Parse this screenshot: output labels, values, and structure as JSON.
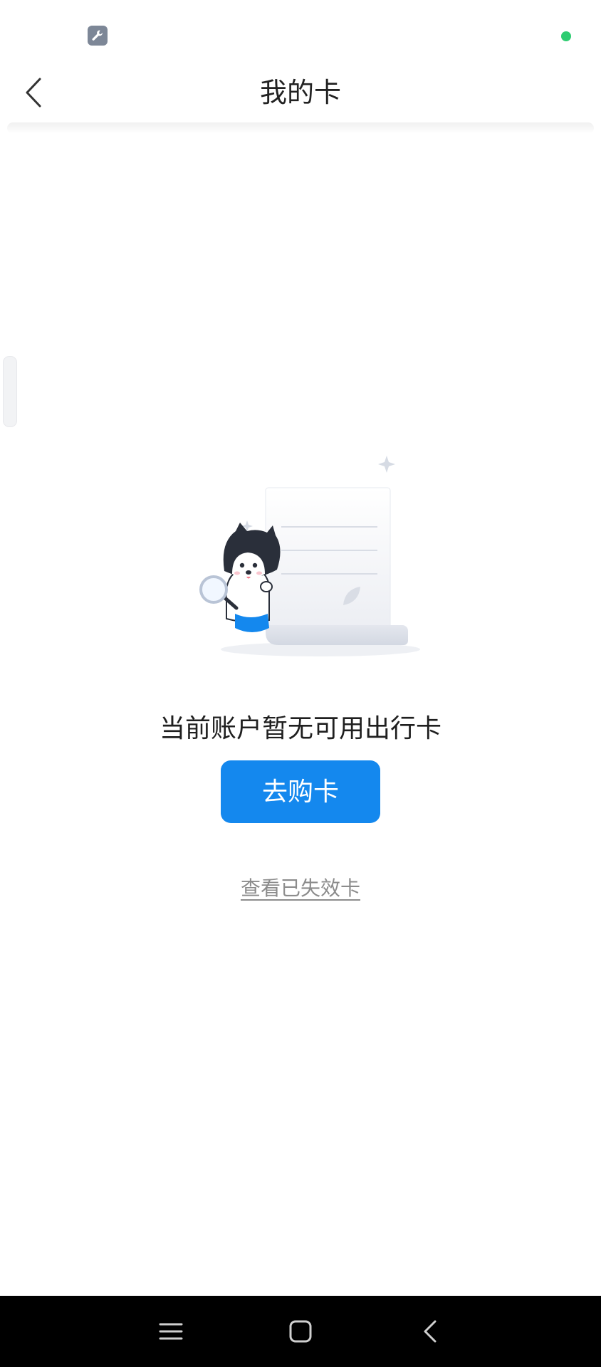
{
  "status_bar": {
    "tool_icon": "wrench-icon",
    "indicator_color": "#2ecc71"
  },
  "header": {
    "title": "我的卡",
    "back_icon": "chevron-left-icon"
  },
  "empty_state": {
    "illustration": "mascot-with-magnifier-and-paper",
    "message": "当前账户暂无可用出行卡",
    "primary_button": "去购卡",
    "secondary_link": "查看已失效卡"
  },
  "colors": {
    "accent": "#1488ee",
    "link": "#8c8c8c",
    "title": "#222222"
  },
  "nav_bar": {
    "items": [
      "menu-icon",
      "home-icon",
      "back-icon"
    ]
  }
}
